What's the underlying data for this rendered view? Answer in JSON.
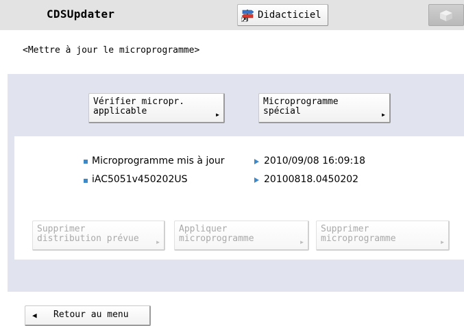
{
  "header": {
    "app_title": "CDSUpdater",
    "tutorial_label": "Didacticiel"
  },
  "screen": {
    "title": "<Mettre à jour le microprogramme>"
  },
  "buttons": {
    "check_applicable": "Vérifier micropr.\napplicable",
    "special_firmware": "Microprogramme\nspécial",
    "cancel_distribution": "Supprimer\ndistribution prévue",
    "apply_firmware": "Appliquer\nmicroprogramme",
    "delete_firmware": "Supprimer\nmicroprogramme",
    "back_to_menu": "Retour au menu"
  },
  "info": {
    "rows": [
      {
        "label": "Microprogramme mis à jour",
        "value": "2010/09/08 16:09:18"
      },
      {
        "label": "iAC5051v450202US",
        "value": "20100818.0450202"
      }
    ]
  },
  "icons": {
    "tutorial": "signpost-icon",
    "corner": "box-icon",
    "back": "left-triangle-icon"
  },
  "colors": {
    "header_bg": "#e3e3e3",
    "panel_bg": "#e1e4ef",
    "accent": "#3f88c8",
    "disabled_text": "#a9a9a9"
  }
}
